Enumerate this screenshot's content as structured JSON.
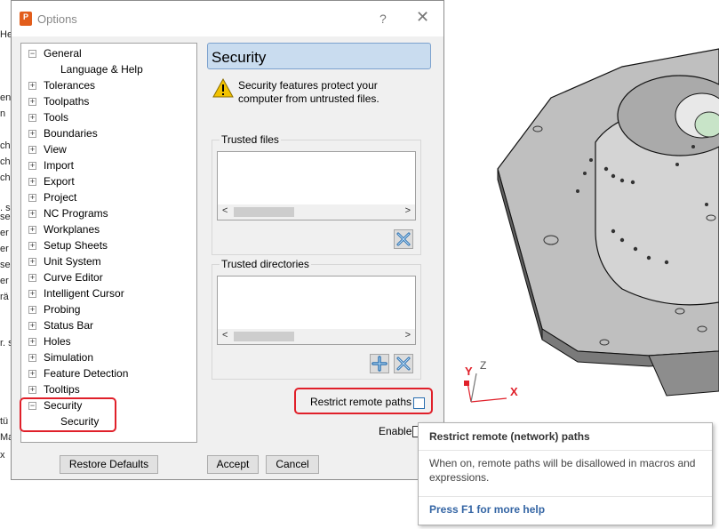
{
  "window": {
    "title": "Options",
    "help_glyph": "?",
    "close_glyph": "✕"
  },
  "background_fragments": [
    "He",
    "en",
    "n",
    "ch",
    "ch",
    "ch",
    ". s",
    "se",
    "er",
    "er",
    "se",
    "er",
    "rä",
    "r. s",
    "tü",
    "Ma",
    "x"
  ],
  "tree": {
    "items": [
      {
        "label": "General",
        "expander": "−",
        "level": 0
      },
      {
        "label": "Language & Help",
        "expander": "",
        "level": 1
      },
      {
        "label": "Tolerances",
        "expander": "+",
        "level": 0
      },
      {
        "label": "Toolpaths",
        "expander": "+",
        "level": 0
      },
      {
        "label": "Tools",
        "expander": "+",
        "level": 0
      },
      {
        "label": "Boundaries",
        "expander": "+",
        "level": 0
      },
      {
        "label": "View",
        "expander": "+",
        "level": 0
      },
      {
        "label": "Import",
        "expander": "+",
        "level": 0
      },
      {
        "label": "Export",
        "expander": "+",
        "level": 0
      },
      {
        "label": "Project",
        "expander": "+",
        "level": 0
      },
      {
        "label": "NC Programs",
        "expander": "+",
        "level": 0
      },
      {
        "label": "Workplanes",
        "expander": "+",
        "level": 0
      },
      {
        "label": "Setup Sheets",
        "expander": "+",
        "level": 0
      },
      {
        "label": "Unit System",
        "expander": "+",
        "level": 0
      },
      {
        "label": "Curve Editor",
        "expander": "+",
        "level": 0
      },
      {
        "label": "Intelligent Cursor",
        "expander": "+",
        "level": 0
      },
      {
        "label": "Probing",
        "expander": "+",
        "level": 0
      },
      {
        "label": "Status Bar",
        "expander": "+",
        "level": 0
      },
      {
        "label": "Holes",
        "expander": "+",
        "level": 0
      },
      {
        "label": "Simulation",
        "expander": "+",
        "level": 0
      },
      {
        "label": "Feature Detection",
        "expander": "+",
        "level": 0
      },
      {
        "label": "Tooltips",
        "expander": "+",
        "level": 0
      },
      {
        "label": "Security",
        "expander": "−",
        "level": 0
      },
      {
        "label": "Security",
        "expander": "",
        "level": 1
      }
    ]
  },
  "panel": {
    "title": "Security",
    "warning": "Security features protect your computer from untrusted files.",
    "trusted_files_label": "Trusted files",
    "trusted_dirs_label": "Trusted directories",
    "restrict_label": "Restrict remote paths",
    "enable_label": "Enable"
  },
  "buttons": {
    "restore": "Restore Defaults",
    "accept": "Accept",
    "cancel": "Cancel"
  },
  "tooltip": {
    "title": "Restrict remote (network) paths",
    "body": "When on, remote paths will be disallowed in macros and expressions.",
    "help": "Press F1 for more help"
  },
  "viewport": {
    "axis_x": "X",
    "axis_y": "Y",
    "axis_z": "Z"
  },
  "colors": {
    "accent_red": "#e0202a",
    "panel_header": "#c9dcef",
    "link_blue": "#3465a4",
    "app_icon": "#e25d1b"
  }
}
